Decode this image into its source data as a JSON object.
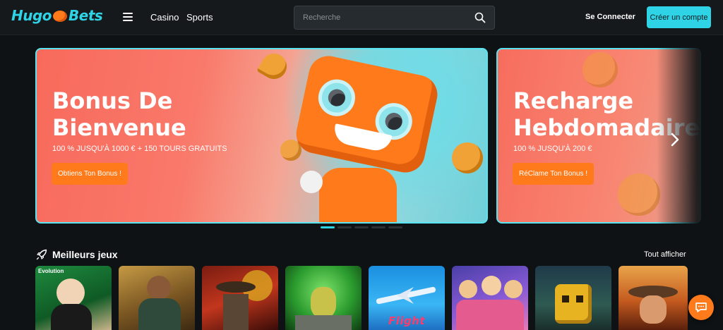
{
  "header": {
    "logo_left": "Hugo",
    "logo_right": "Bets",
    "nav": [
      {
        "label": "Casino"
      },
      {
        "label": "Sports"
      }
    ],
    "search_placeholder": "Recherche",
    "login_label": "Se Connecter",
    "signup_label": "Créer un compte"
  },
  "banners": [
    {
      "title_line1": "Bonus De",
      "title_line2": "Bienvenue",
      "subtitle": "100 % JUSQU'À 1000 € + 150 TOURS GRATUITS",
      "cta": "Obtiens Ton Bonus !"
    },
    {
      "title_line1": "Recharge",
      "title_line2": "Hebdomadaire",
      "subtitle": "100 % JUSQU'À 200 €",
      "cta": "RéClame Ton Bonus !"
    }
  ],
  "carousel": {
    "slides": 5,
    "active": 0
  },
  "games_section": {
    "title": "Meilleurs jeux",
    "see_all": "Tout afficher",
    "games": [
      {
        "tag": "Evolution",
        "label": ""
      },
      {
        "tag": "",
        "label": ""
      },
      {
        "tag": "",
        "label": ""
      },
      {
        "tag": "",
        "label": ""
      },
      {
        "tag": "",
        "label": "Flight"
      },
      {
        "tag": "",
        "label": ""
      },
      {
        "tag": "",
        "label": ""
      },
      {
        "tag": "",
        "label": ""
      }
    ]
  },
  "colors": {
    "accent": "#2ed3e6",
    "orange": "#ff7a1a",
    "background": "#0f1214",
    "header": "#15191c"
  },
  "icons": {
    "menu": "hamburger-icon",
    "search": "search-icon",
    "next": "chevron-right-icon",
    "section": "rocket-icon",
    "chat": "chat-bubble-icon"
  }
}
